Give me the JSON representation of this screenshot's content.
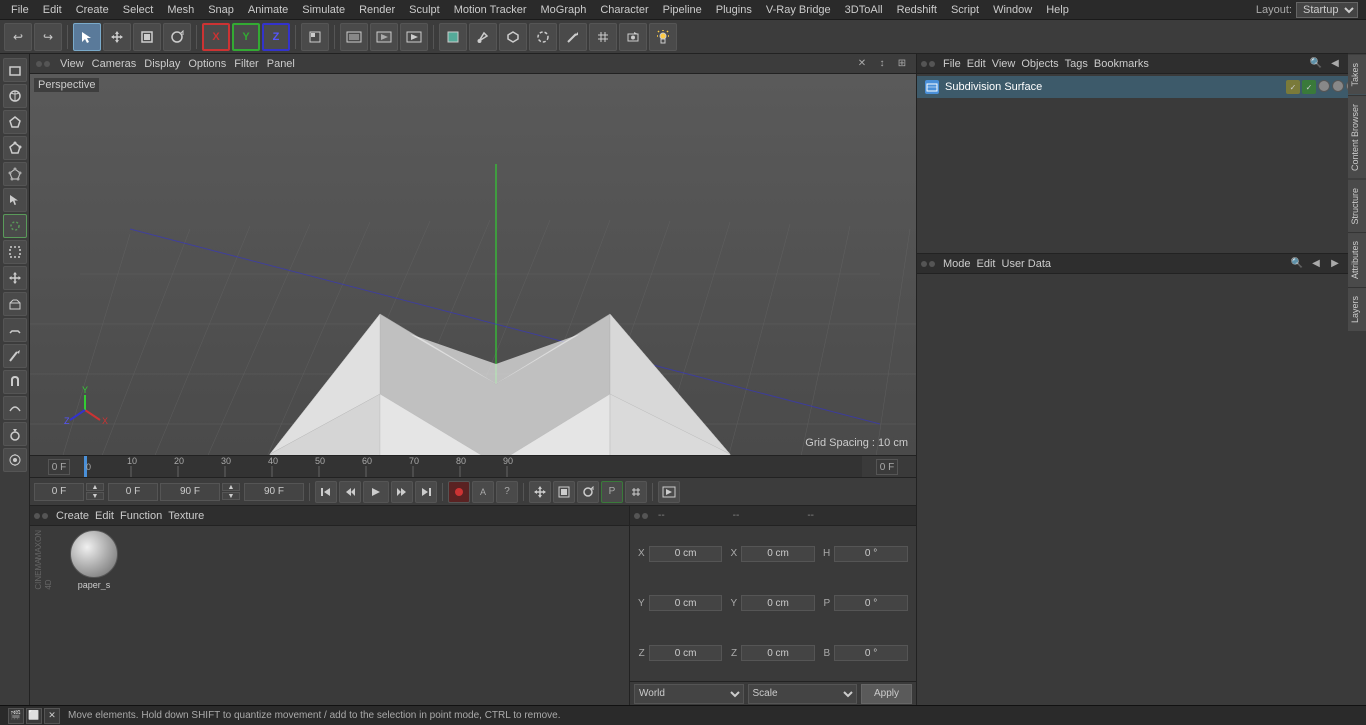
{
  "app": {
    "title": "Cinema 4D"
  },
  "menu": {
    "items": [
      "File",
      "Edit",
      "Create",
      "Select",
      "Mesh",
      "Snap",
      "Animate",
      "Simulate",
      "Render",
      "Sculpt",
      "Motion Tracker",
      "MoGraph",
      "Character",
      "Pipeline",
      "Plugins",
      "V-Ray Bridge",
      "3DToAll",
      "Redshift",
      "Script",
      "Window",
      "Help"
    ],
    "layout_label": "Layout:",
    "layout_value": "Startup"
  },
  "toolbar": {
    "undo_label": "↩",
    "redo_label": "↪",
    "mode_select": "↖",
    "mode_move": "✛",
    "mode_scale": "⊡",
    "mode_rotate": "↻",
    "axis_x": "X",
    "axis_y": "Y",
    "axis_z": "Z",
    "coord_btn": "⊞",
    "render_btn": "▶",
    "light_btn": "💡"
  },
  "viewport": {
    "label": "Perspective",
    "header_items": [
      "View",
      "Cameras",
      "Display",
      "Options",
      "Filter",
      "Panel"
    ],
    "grid_spacing": "Grid Spacing : 10 cm"
  },
  "timeline": {
    "ticks": [
      0,
      10,
      20,
      30,
      40,
      50,
      60,
      70,
      80,
      90
    ],
    "current_frame": "0 F",
    "frame_indicator": "0 F"
  },
  "playback": {
    "start_frame": "0 F",
    "current_frame": "0 F",
    "end_frame": "90 F",
    "end_frame2": "90 F",
    "btn_start": "⏮",
    "btn_prev_key": "◀◀",
    "btn_play": "▶",
    "btn_next_key": "▶▶",
    "btn_end": "⏭",
    "btn_record": "⏺",
    "btn_auto": "A",
    "btn_help": "?",
    "move_icon": "✛",
    "scale_icon": "⊡",
    "rotate_icon": "↻",
    "pivot_icon": "P",
    "grid_icon": "⊞",
    "render_small": "▶"
  },
  "object_manager": {
    "header_items": [
      "File",
      "Edit",
      "View",
      "Objects",
      "Tags",
      "Bookmarks"
    ],
    "panel_icons": [
      "🔍",
      "◀",
      "▶"
    ],
    "objects": [
      {
        "name": "Subdivision Surface",
        "icon_color": "#4a90d9",
        "tags": [
          "✓",
          "✓"
        ]
      }
    ]
  },
  "attributes_panel": {
    "header_items": [
      "Mode",
      "Edit",
      "User Data"
    ],
    "panel_icons": [
      "🔍",
      "◀",
      "▶",
      "⊞"
    ]
  },
  "material_panel": {
    "header_items": [
      "Create",
      "Edit",
      "Function",
      "Texture"
    ],
    "materials": [
      {
        "name": "paper_s",
        "color_center": "#e8e8e8",
        "color_mid": "#aaaaaa",
        "color_edge": "#666666"
      }
    ]
  },
  "coordinates": {
    "x_pos_label": "X",
    "y_pos_label": "Y",
    "z_pos_label": "Z",
    "x_pos": "0 cm",
    "y_pos": "0 cm",
    "z_pos": "0 cm",
    "x_rot_label": "X",
    "y_rot_label": "Y",
    "z_rot_label": "Z",
    "x_rot": "0 cm",
    "y_rot": "0 cm",
    "z_rot": "0 cm",
    "h_label": "H",
    "p_label": "P",
    "b_label": "B",
    "h_val": "0 °",
    "p_val": "0 °",
    "b_val": "0 °",
    "col1_label": "--",
    "col2_label": "--",
    "col3_label": "--",
    "world_label": "World",
    "scale_label": "Scale",
    "apply_label": "Apply"
  },
  "status_bar": {
    "text": "Move elements. Hold down SHIFT to quantize movement / add to the selection in point mode, CTRL to remove.",
    "icons": [
      "🎬",
      "⬜",
      "✕"
    ]
  },
  "right_tabs": [
    "Takes",
    "Content Browser",
    "Structure",
    "Attributes",
    "Layers"
  ],
  "colors": {
    "accent_blue": "#4a90d9",
    "bg_dark": "#2a2a2a",
    "bg_mid": "#3a3a3a",
    "bg_light": "#4a4a4a",
    "border": "#222222",
    "text_main": "#cccccc",
    "text_dim": "#aaaaaa",
    "selected_row": "#3d5a6a",
    "axis_x": "#cc3333",
    "axis_y": "#33aa33",
    "axis_z": "#3333cc"
  }
}
